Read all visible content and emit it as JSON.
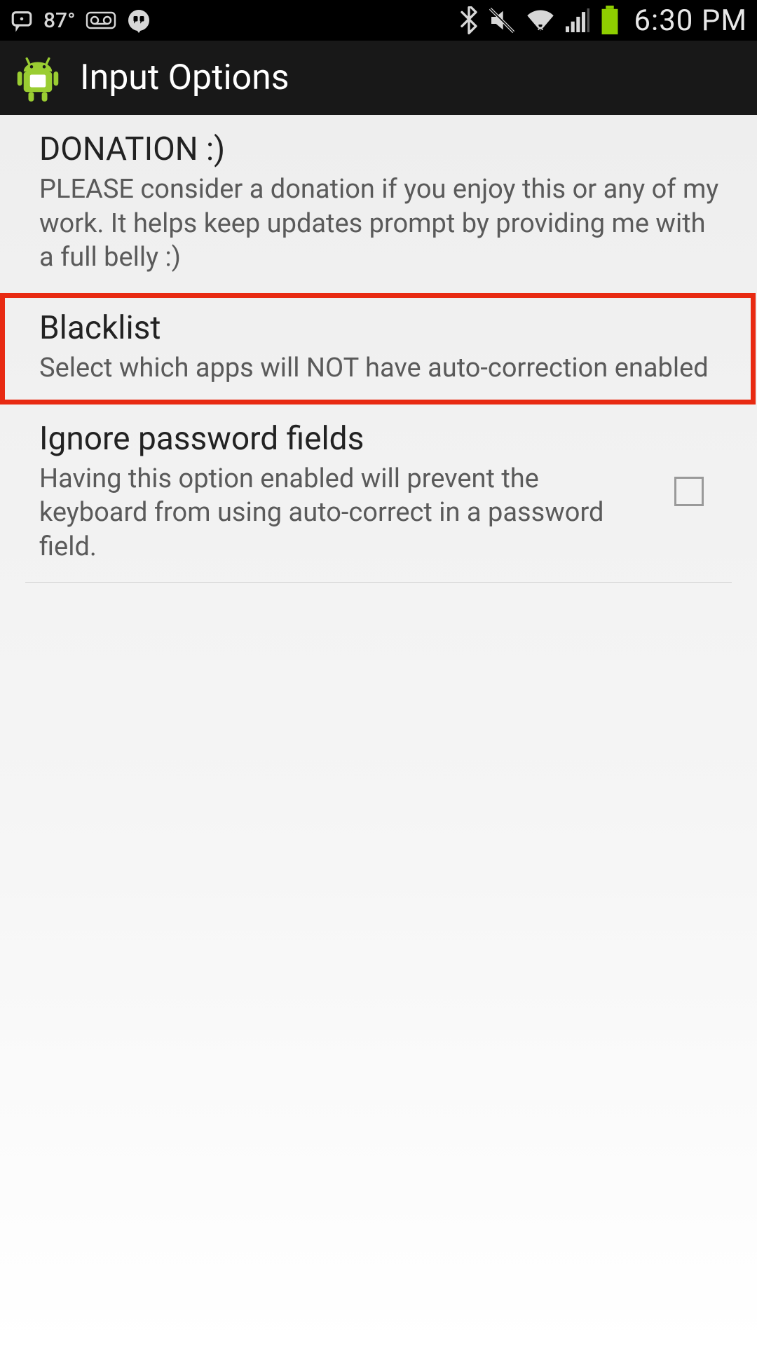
{
  "status_bar": {
    "temperature": "87°",
    "time": "6:30 PM",
    "icons": {
      "notification1": "chat-outline",
      "voicemail": "voicemail",
      "hangouts": "hangouts",
      "bluetooth": "bluetooth",
      "volume_mute": "volume-mute",
      "wifi": "wifi",
      "cellular": "cellular-signal",
      "battery": "battery-full"
    },
    "colors": {
      "battery": "#8fce00",
      "icon": "#d7d7d7",
      "bg": "#000000"
    }
  },
  "title_bar": {
    "app_icon": "android-robot",
    "title": "Input Options"
  },
  "prefs": {
    "donation": {
      "title": "DONATION :)",
      "summary": "PLEASE consider a donation if you enjoy this or any of my work. It helps keep updates prompt by providing me with a full belly :)"
    },
    "blacklist": {
      "title": "Blacklist",
      "summary": "Select which apps will NOT have auto-correction enabled",
      "highlighted": true
    },
    "ignore_password": {
      "title": "Ignore password fields",
      "summary": "Having this option enabled will prevent the keyboard from using auto-correct in a password field.",
      "checked": false
    }
  },
  "highlight_color": "#e82a12"
}
